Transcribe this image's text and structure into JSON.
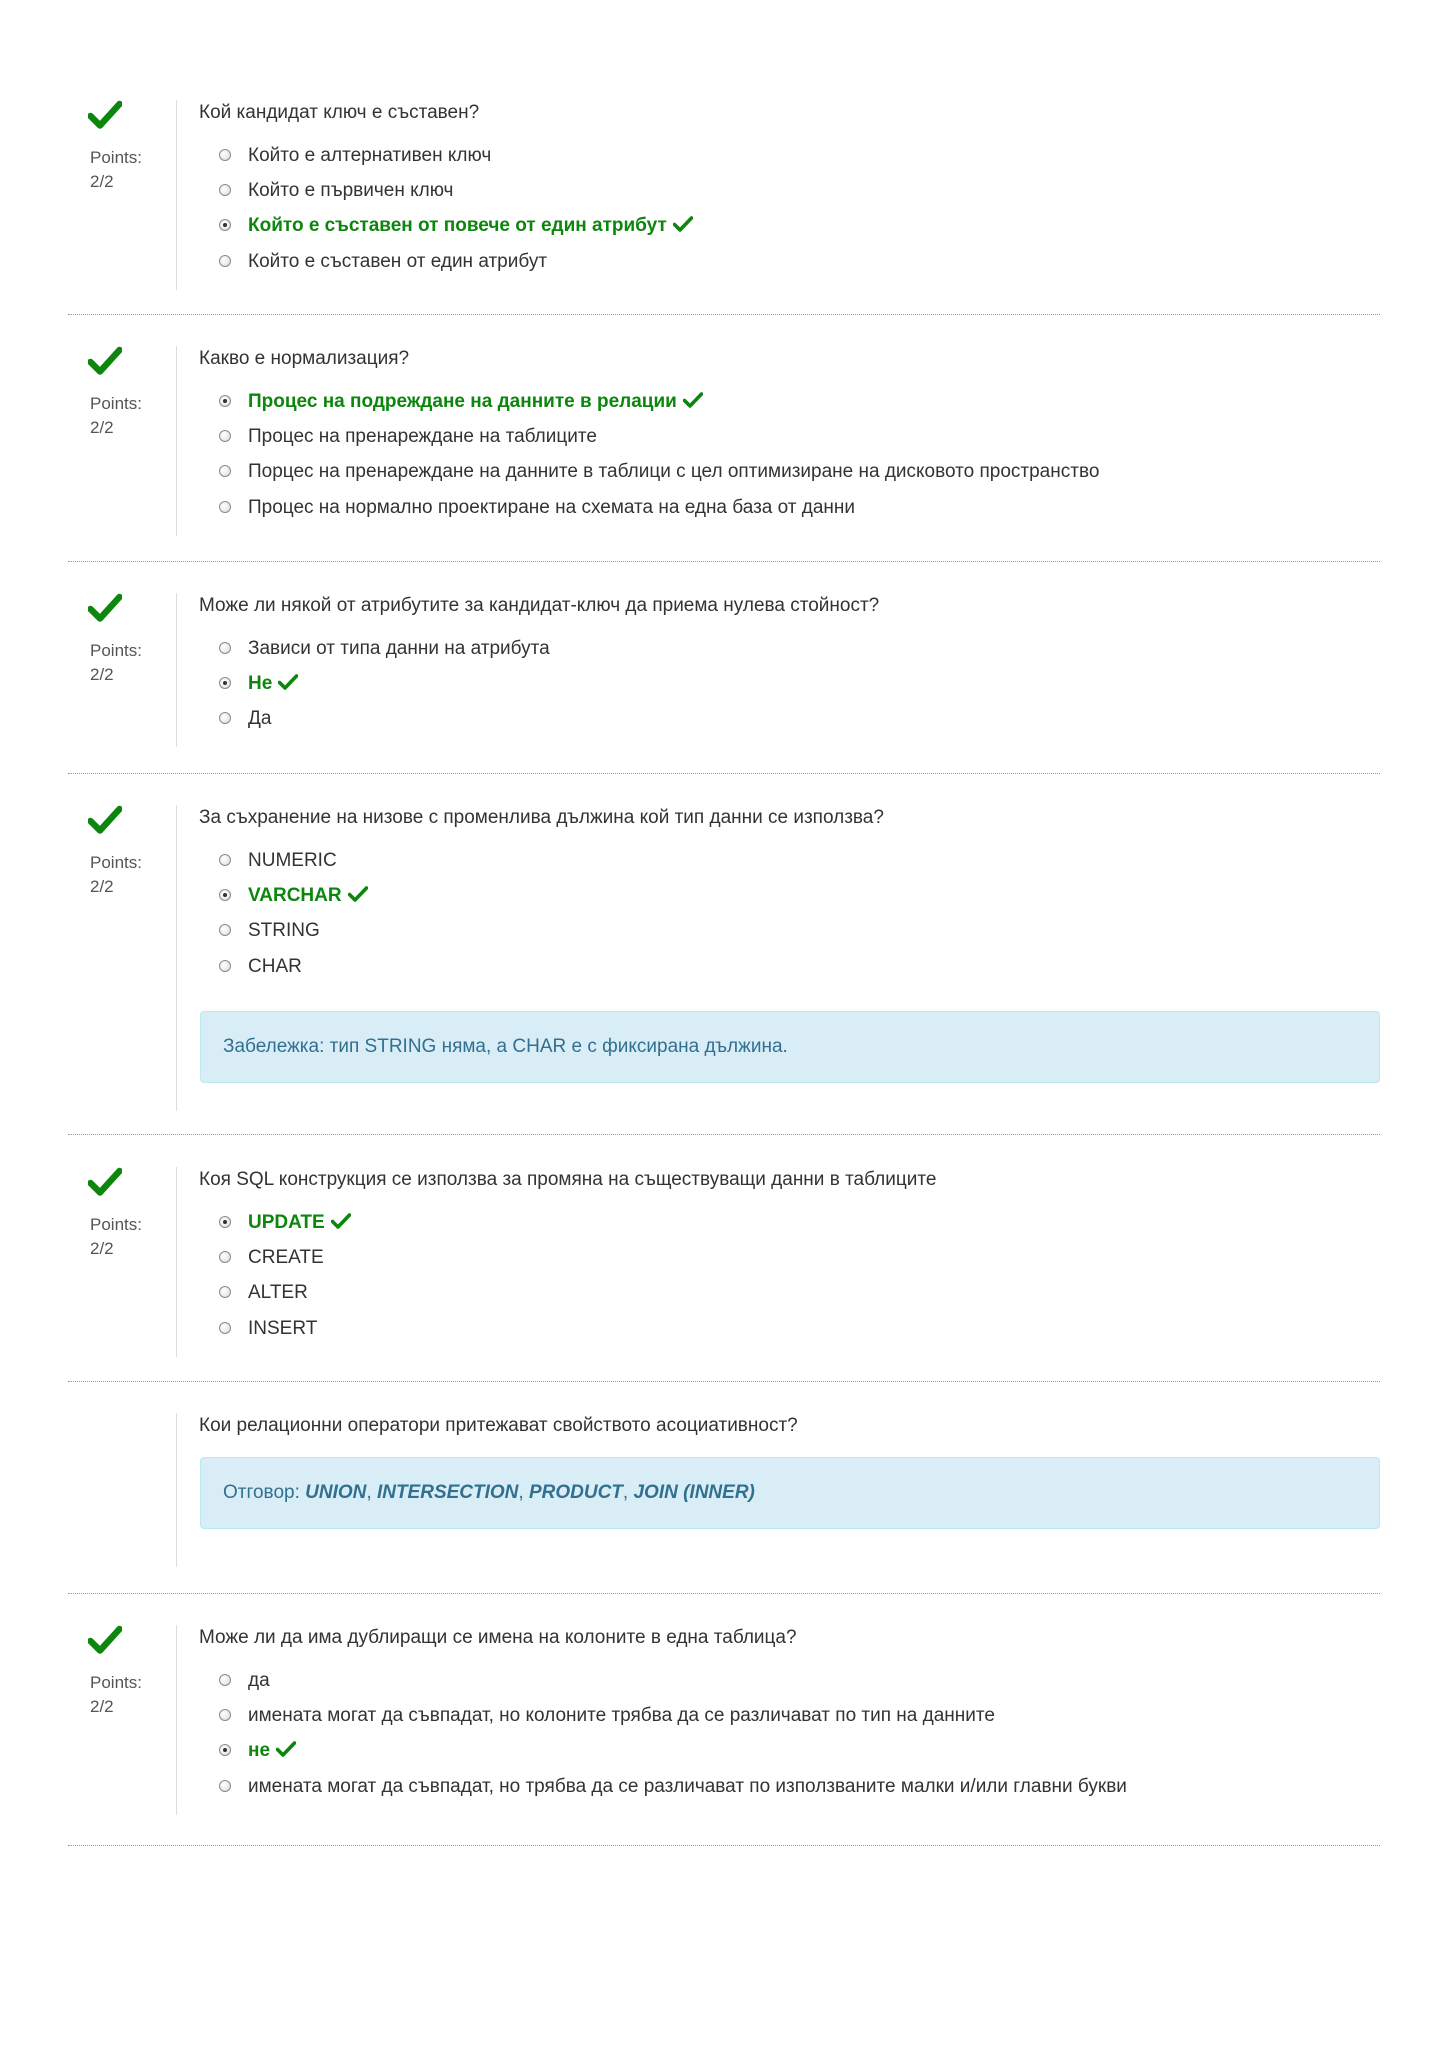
{
  "questions": [
    {
      "question": "Кой кандидат ключ е съставен?",
      "points_label": "Points:",
      "points_value": "2/2",
      "correct": true,
      "options": [
        {
          "text": "Който е алтернативен ключ",
          "selected": false,
          "correct": false
        },
        {
          "text": "Който е първичен ключ",
          "selected": false,
          "correct": false
        },
        {
          "text": "Който е съставен от повече от един атрибут",
          "selected": true,
          "correct": true
        },
        {
          "text": "Който е съставен от един атрибут",
          "selected": false,
          "correct": false
        }
      ]
    },
    {
      "question": "Какво е нормализация?",
      "points_label": "Points:",
      "points_value": "2/2",
      "correct": true,
      "options": [
        {
          "text": "Процес на подреждане на данните в релации",
          "selected": true,
          "correct": true
        },
        {
          "text": "Процес на пренареждане на таблиците",
          "selected": false,
          "correct": false
        },
        {
          "text": "Порцес на пренареждане на данните в таблици с цел оптимизиране на дисковото пространство",
          "selected": false,
          "correct": false
        },
        {
          "text": "Процес на нормално проектиране на схемата на една база от данни",
          "selected": false,
          "correct": false
        }
      ]
    },
    {
      "question": "Може ли някой от атрибутите за кандидат-ключ да приема нулева стойност?",
      "points_label": "Points:",
      "points_value": "2/2",
      "correct": true,
      "options": [
        {
          "text": "Зависи от типа данни на атрибута",
          "selected": false,
          "correct": false
        },
        {
          "text": "Не",
          "selected": true,
          "correct": true
        },
        {
          "text": "Да",
          "selected": false,
          "correct": false
        }
      ]
    },
    {
      "question": "За съхранение на низове с променлива дължина кой тип данни се използва?",
      "points_label": "Points:",
      "points_value": "2/2",
      "correct": true,
      "options": [
        {
          "text": "NUMERIC",
          "selected": false,
          "correct": false
        },
        {
          "text": "VARCHAR",
          "selected": true,
          "correct": true
        },
        {
          "text": "STRING",
          "selected": false,
          "correct": false
        },
        {
          "text": "CHAR",
          "selected": false,
          "correct": false
        }
      ],
      "note": "Забележка: тип STRING няма, а CHAR е с фиксирана дължина."
    },
    {
      "question": "Коя SQL конструкция се използва за промяна на съществуващи данни в таблиците",
      "points_label": "Points:",
      "points_value": "2/2",
      "correct": true,
      "options": [
        {
          "text": "UPDATE",
          "selected": true,
          "correct": true
        },
        {
          "text": "CREATE",
          "selected": false,
          "correct": false
        },
        {
          "text": "ALTER",
          "selected": false,
          "correct": false
        },
        {
          "text": "INSERT",
          "selected": false,
          "correct": false
        }
      ]
    },
    {
      "question": "Кои релационни оператори притежават свойството асоциативност?",
      "correct": null,
      "options": [],
      "answer": {
        "prefix": "Отговор:",
        "terms": [
          "UNION",
          "INTERSECTION",
          "PRODUCT",
          "JOIN (INNER)"
        ],
        "separator": ","
      }
    },
    {
      "question": "Може ли да има дублиращи се имена на колоните в една таблица?",
      "points_label": "Points:",
      "points_value": "2/2",
      "correct": true,
      "options": [
        {
          "text": "да",
          "selected": false,
          "correct": false
        },
        {
          "text": "имената могат да съвпадат, но колоните трябва да се различават по тип на данните",
          "selected": false,
          "correct": false
        },
        {
          "text": "не",
          "selected": true,
          "correct": true
        },
        {
          "text": "имената могат да съвпадат, но трябва да се различават по използваните малки и/или главни букви",
          "selected": false,
          "correct": false
        }
      ]
    }
  ],
  "colors": {
    "correct": "#0d860d",
    "note_background": "#d9edf7",
    "note_text": "#31708f",
    "divider": "#999999"
  },
  "icons": {
    "correct_mark": "checkmark-icon",
    "option_selector": "radio-icon"
  }
}
